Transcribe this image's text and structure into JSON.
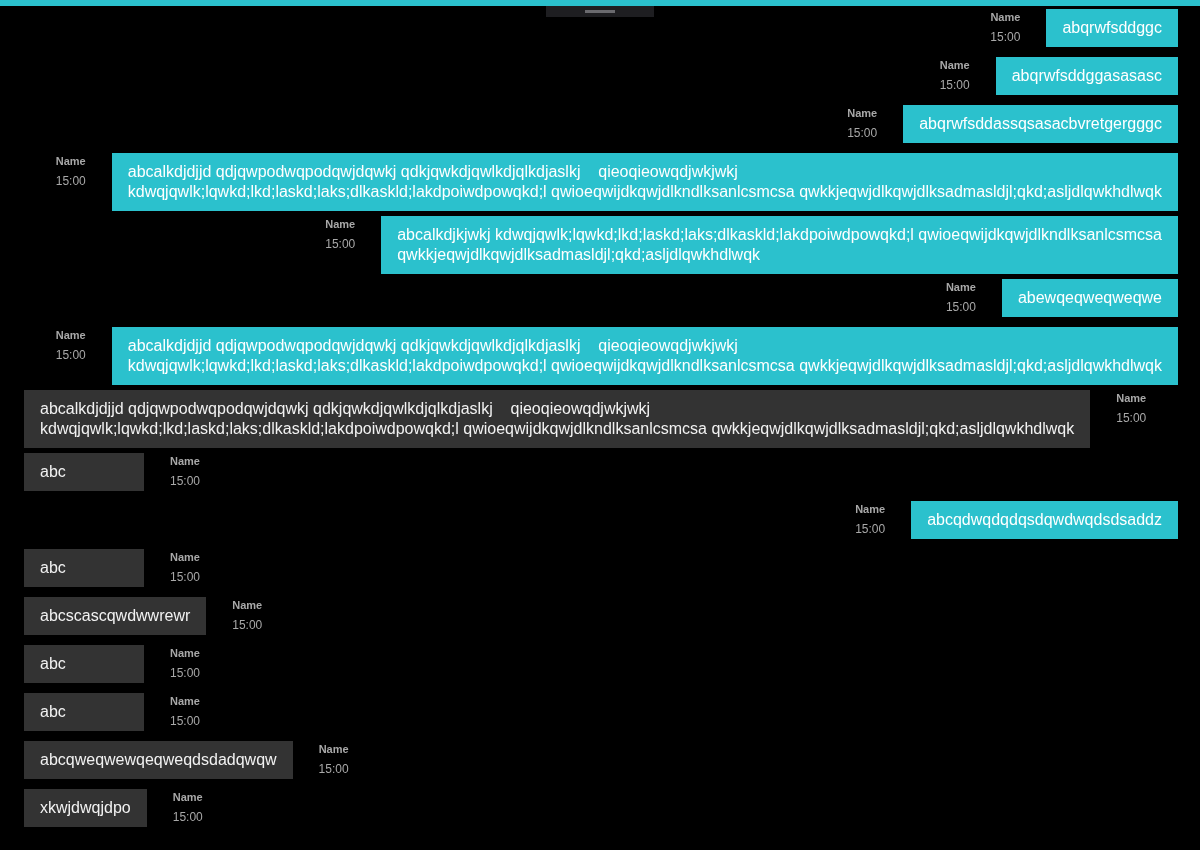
{
  "messages": [
    {
      "kind": "sent",
      "name": "Name",
      "time": "15:00",
      "text": "abqrwfsddggc"
    },
    {
      "kind": "sent",
      "name": "Name",
      "time": "15:00",
      "text": "abqrwfsddggasasasc"
    },
    {
      "kind": "sent",
      "name": "Name",
      "time": "15:00",
      "text": "abqrwfsddassqsasacbvretgergggc"
    },
    {
      "kind": "sent",
      "name": "Name",
      "time": "15:00",
      "text": "abcalkdjdjjd qdjqwpodwqpodqwjdqwkj qdkjqwkdjqwlkdjqlkdjaslkj    qieoqieowqdjwkjwkj\nkdwqjqwlk;lqwkd;lkd;laskd;laks;dlkaskld;lakdpoiwdpowqkd;l qwioeqwijdkqwjdlkndlksanlcsmcsa qwkkjeqwjdlkqwjdlksadmasldjl;qkd;asljdlqwkhdlwqk"
    },
    {
      "kind": "sent",
      "name": "Name",
      "time": "15:00",
      "text": "abcalkdjkjwkj kdwqjqwlk;lqwkd;lkd;laskd;laks;dlkaskld;lakdpoiwdpowqkd;l qwioeqwijdkqwjdlkndlksanlcsmcsa\nqwkkjeqwjdlkqwjdlksadmasldjl;qkd;asljdlqwkhdlwqk"
    },
    {
      "kind": "sent",
      "name": "Name",
      "time": "15:00",
      "text": "abewqeqweqweqwe"
    },
    {
      "kind": "sent",
      "name": "Name",
      "time": "15:00",
      "text": "abcalkdjdjjd qdjqwpodwqpodqwjdqwkj qdkjqwkdjqwlkdjqlkdjaslkj    qieoqieowqdjwkjwkj\nkdwqjqwlk;lqwkd;lkd;laskd;laks;dlkaskld;lakdpoiwdpowqkd;l qwioeqwijdkqwjdlkndlksanlcsmcsa qwkkjeqwjdlkqwjdlksadmasldjl;qkd;asljdlqwkhdlwqk"
    },
    {
      "kind": "received",
      "name": "Name",
      "time": "15:00",
      "text": "abcalkdjdjjd qdjqwpodwqpodqwjdqwkj qdkjqwkdjqwlkdjqlkdjaslkj    qieoqieowqdjwkjwkj\nkdwqjqwlk;lqwkd;lkd;laskd;laks;dlkaskld;lakdpoiwdpowqkd;l qwioeqwijdkqwjdlkndlksanlcsmcsa qwkkjeqwjdlkqwjdlksadmasldjl;qkd;asljdlqwkhdlwqk"
    },
    {
      "kind": "received",
      "name": "Name",
      "time": "15:00",
      "text": "abc"
    },
    {
      "kind": "sent",
      "name": "Name",
      "time": "15:00",
      "text": "abcqdwqdqdqsdqwdwqdsdsaddz"
    },
    {
      "kind": "received",
      "name": "Name",
      "time": "15:00",
      "text": "abc"
    },
    {
      "kind": "received",
      "name": "Name",
      "time": "15:00",
      "text": "abcscascqwdwwrewr"
    },
    {
      "kind": "received",
      "name": "Name",
      "time": "15:00",
      "text": "abc"
    },
    {
      "kind": "received",
      "name": "Name",
      "time": "15:00",
      "text": "abc"
    },
    {
      "kind": "received",
      "name": "Name",
      "time": "15:00",
      "text": "abcqweqwewqeqweqdsdadqwqw"
    },
    {
      "kind": "received",
      "name": "Name",
      "time": "15:00",
      "text": "xkwjdwqjdpo"
    }
  ]
}
